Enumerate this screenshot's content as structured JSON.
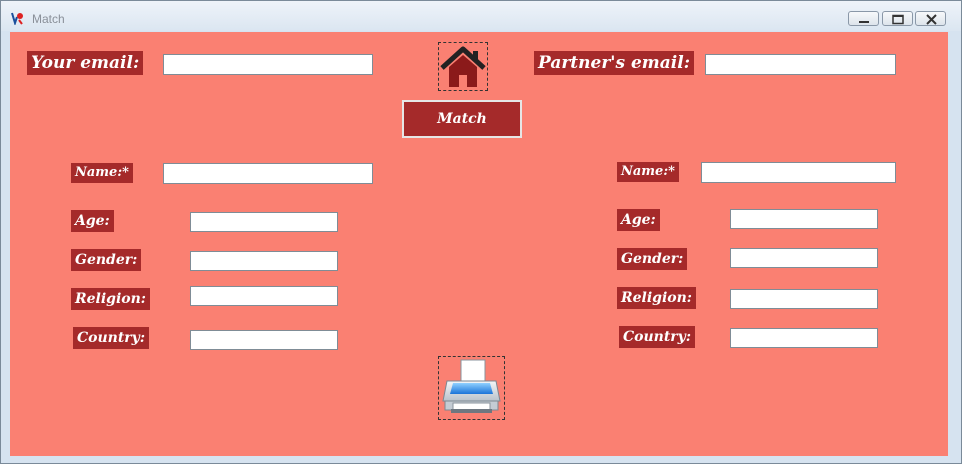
{
  "window": {
    "title": "Match",
    "controls": {
      "minimize": "minimize-icon",
      "maximize": "maximize-icon",
      "close": "close-icon"
    }
  },
  "header": {
    "your_email_label": "Your email:",
    "your_email_value": "",
    "partner_email_label": "Partner's email:",
    "partner_email_value": "",
    "home_icon": "home-icon",
    "match_button": "Match"
  },
  "left": {
    "name_label": "Name:*",
    "name_value": "",
    "age_label": "Age:",
    "age_value": "",
    "gender_label": "Gender:",
    "gender_value": "",
    "religion_label": "Religion:",
    "religion_value": "",
    "country_label": "Country:",
    "country_value": ""
  },
  "right": {
    "name_label": "Name:*",
    "name_value": "",
    "age_label": "Age:",
    "age_value": "",
    "gender_label": "Gender:",
    "gender_value": "",
    "religion_label": "Religion:",
    "religion_value": "",
    "country_label": "Country:",
    "country_value": ""
  },
  "footer": {
    "print_icon": "printer-icon"
  },
  "colors": {
    "background": "#fa8072",
    "label": "#a52a2a",
    "titlebar": "#dbe6f1"
  }
}
